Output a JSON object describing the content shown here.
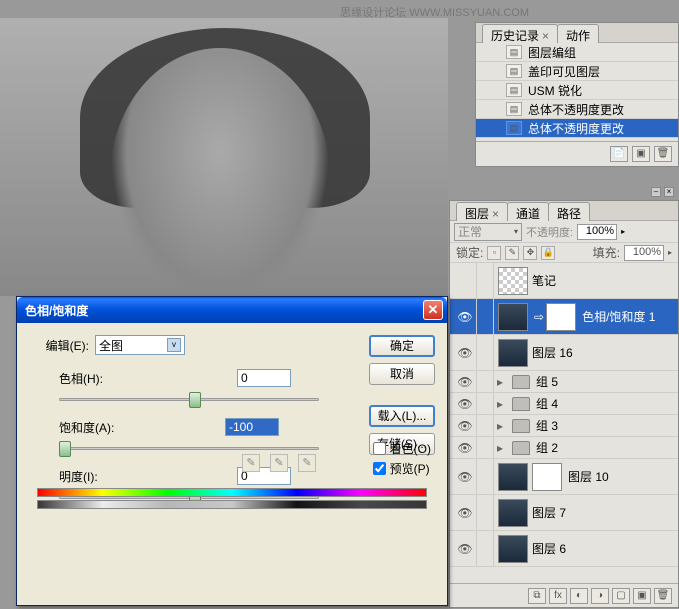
{
  "watermark": "思缘设计论坛  WWW.MISSYUAN.COM",
  "history": {
    "tabs": [
      "历史记录",
      "动作"
    ],
    "items": [
      {
        "label": "图层编组"
      },
      {
        "label": "盖印可见图层"
      },
      {
        "label": "USM 锐化"
      },
      {
        "label": "总体不透明度更改"
      },
      {
        "label": "总体不透明度更改"
      }
    ]
  },
  "layers": {
    "tabs": [
      "图层",
      "通道",
      "路径"
    ],
    "blend_mode": "正常",
    "opacity_label": "不透明度:",
    "opacity_value": "100%",
    "lock_label": "锁定:",
    "fill_label": "填充:",
    "fill_value": "100%",
    "items": [
      {
        "name": "笔记",
        "eye": false,
        "type": "layer"
      },
      {
        "name": "色相/饱和度 1",
        "eye": true,
        "type": "adj",
        "selected": true
      },
      {
        "name": "图层 16",
        "eye": true,
        "type": "img"
      },
      {
        "name": "组 5",
        "eye": true,
        "type": "group"
      },
      {
        "name": "组 4",
        "eye": true,
        "type": "group"
      },
      {
        "name": "组 3",
        "eye": true,
        "type": "group"
      },
      {
        "name": "组 2",
        "eye": true,
        "type": "group"
      },
      {
        "name": "图层 10",
        "eye": true,
        "type": "masked"
      },
      {
        "name": "图层 7",
        "eye": true,
        "type": "img"
      },
      {
        "name": "图层 6",
        "eye": true,
        "type": "img"
      }
    ]
  },
  "dialog": {
    "title": "色相/饱和度",
    "edit_label": "编辑(E):",
    "edit_value": "全图",
    "hue_label": "色相(H):",
    "hue_value": "0",
    "sat_label": "饱和度(A):",
    "sat_value": "-100",
    "light_label": "明度(I):",
    "light_value": "0",
    "ok": "确定",
    "cancel": "取消",
    "load": "载入(L)...",
    "save": "存储(S)...",
    "colorize": "着色(O)",
    "preview": "预览(P)"
  }
}
